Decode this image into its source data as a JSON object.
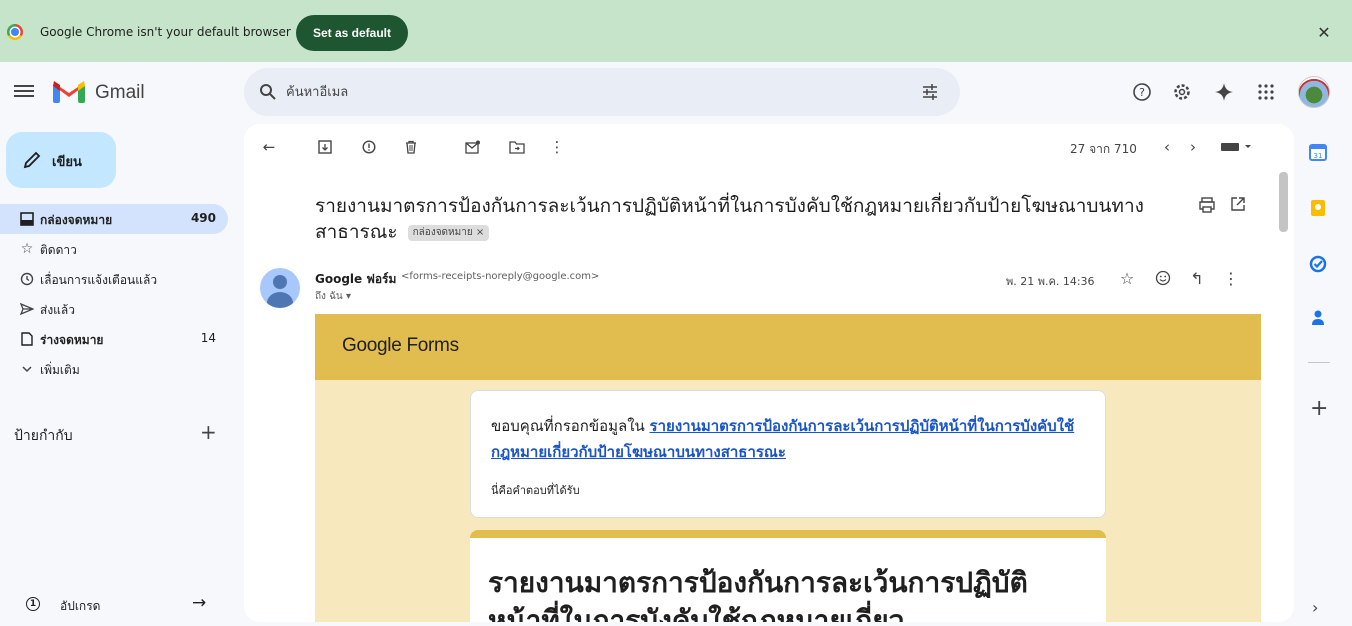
{
  "banner": {
    "message": "Google Chrome isn't your default browser",
    "set_default_label": "Set as default",
    "close_label": "✕"
  },
  "header": {
    "app_name": "Gmail",
    "search_placeholder": "ค้นหาอีเมล"
  },
  "sidebar": {
    "compose_label": "เขียน",
    "items": [
      {
        "label": "กล่องจดหมาย",
        "count": "490",
        "icon": "inbox-icon",
        "active": true
      },
      {
        "label": "ติดดาว",
        "count": "",
        "icon": "star-icon",
        "active": false
      },
      {
        "label": "เลื่อนการแจ้งเตือนแล้ว",
        "count": "",
        "icon": "clock-icon",
        "active": false
      },
      {
        "label": "ส่งแล้ว",
        "count": "",
        "icon": "send-icon",
        "active": false
      },
      {
        "label": "ร่างจดหมาย",
        "count": "14",
        "icon": "draft-icon",
        "active": false
      },
      {
        "label": "เพิ่มเติม",
        "count": "",
        "icon": "chevron-down-icon",
        "active": false
      }
    ],
    "labels_title": "ป้ายกำกับ",
    "upgrade_label": "อัปเกรด"
  },
  "toolbar": {
    "page_count": "27 จาก 710"
  },
  "email": {
    "subject": "รายงานมาตรการป้องกันการละเว้นการปฏิบัติหน้าที่ในการบังคับใช้กฎหมายเกี่ยวกับป้ายโฆษณาบนทาง สาธารณะ",
    "label_chip": "กล่องจดหมาย ×",
    "sender_name": "Google ฟอร์ม",
    "sender_email": "<forms-receipts-noreply@google.com>",
    "to": "ถึง ฉัน ▾",
    "date": "พ. 21 พ.ค. 14:36"
  },
  "body": {
    "forms_logo": "Google Forms",
    "thanks_prefix": "ขอบคุณที่กรอกข้อมูลใน ",
    "thanks_link": "รายงานมาตรการป้องกันการละเว้นการปฏิบัติหน้าที่ในการบังคับใช้กฎหมายเกี่ยวกับป้ายโฆษณาบนทางสาธารณะ",
    "receipt_note": "นี่คือคำตอบที่ได้รับ",
    "form_title": "รายงานมาตรการป้องกันการละเว้นการปฏิบัติหน้าที่ในการบังคับใช้กฎหมายเกี่ยว"
  },
  "colors": {
    "banner_bg": "#c6e4c9",
    "set_default_bg": "#1e5631",
    "compose_bg": "#c2e7ff",
    "active_nav_bg": "#d3e3fd",
    "forms_header": "#e1bc4f",
    "forms_body": "#f8e8be",
    "link": "#1a55c8"
  }
}
